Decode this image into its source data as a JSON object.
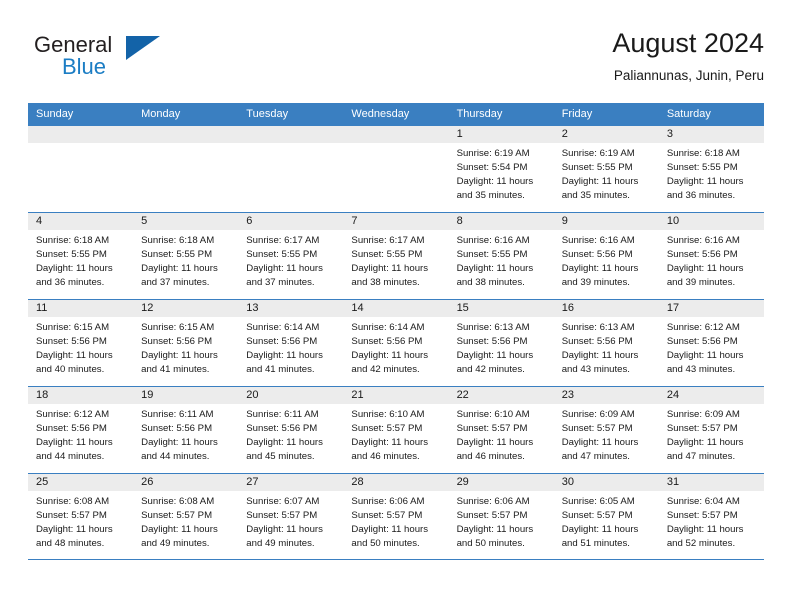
{
  "logo": {
    "word_top": "General",
    "word_bottom": "Blue",
    "triangle_color": "#1363a8",
    "blue_color": "#1b7dc4"
  },
  "header": {
    "title": "August 2024",
    "subtitle": "Paliannunas, Junin, Peru"
  },
  "theme": {
    "header_blue": "#3a7fc1",
    "day_band_gray": "#ececec"
  },
  "weekdays": [
    "Sunday",
    "Monday",
    "Tuesday",
    "Wednesday",
    "Thursday",
    "Friday",
    "Saturday"
  ],
  "weeks": [
    [
      {
        "day": "",
        "sunrise": "",
        "sunset": "",
        "daylight_line1": "",
        "daylight_line2": ""
      },
      {
        "day": "",
        "sunrise": "",
        "sunset": "",
        "daylight_line1": "",
        "daylight_line2": ""
      },
      {
        "day": "",
        "sunrise": "",
        "sunset": "",
        "daylight_line1": "",
        "daylight_line2": ""
      },
      {
        "day": "",
        "sunrise": "",
        "sunset": "",
        "daylight_line1": "",
        "daylight_line2": ""
      },
      {
        "day": "1",
        "sunrise": "Sunrise: 6:19 AM",
        "sunset": "Sunset: 5:54 PM",
        "daylight_line1": "Daylight: 11 hours",
        "daylight_line2": "and 35 minutes."
      },
      {
        "day": "2",
        "sunrise": "Sunrise: 6:19 AM",
        "sunset": "Sunset: 5:55 PM",
        "daylight_line1": "Daylight: 11 hours",
        "daylight_line2": "and 35 minutes."
      },
      {
        "day": "3",
        "sunrise": "Sunrise: 6:18 AM",
        "sunset": "Sunset: 5:55 PM",
        "daylight_line1": "Daylight: 11 hours",
        "daylight_line2": "and 36 minutes."
      }
    ],
    [
      {
        "day": "4",
        "sunrise": "Sunrise: 6:18 AM",
        "sunset": "Sunset: 5:55 PM",
        "daylight_line1": "Daylight: 11 hours",
        "daylight_line2": "and 36 minutes."
      },
      {
        "day": "5",
        "sunrise": "Sunrise: 6:18 AM",
        "sunset": "Sunset: 5:55 PM",
        "daylight_line1": "Daylight: 11 hours",
        "daylight_line2": "and 37 minutes."
      },
      {
        "day": "6",
        "sunrise": "Sunrise: 6:17 AM",
        "sunset": "Sunset: 5:55 PM",
        "daylight_line1": "Daylight: 11 hours",
        "daylight_line2": "and 37 minutes."
      },
      {
        "day": "7",
        "sunrise": "Sunrise: 6:17 AM",
        "sunset": "Sunset: 5:55 PM",
        "daylight_line1": "Daylight: 11 hours",
        "daylight_line2": "and 38 minutes."
      },
      {
        "day": "8",
        "sunrise": "Sunrise: 6:16 AM",
        "sunset": "Sunset: 5:55 PM",
        "daylight_line1": "Daylight: 11 hours",
        "daylight_line2": "and 38 minutes."
      },
      {
        "day": "9",
        "sunrise": "Sunrise: 6:16 AM",
        "sunset": "Sunset: 5:56 PM",
        "daylight_line1": "Daylight: 11 hours",
        "daylight_line2": "and 39 minutes."
      },
      {
        "day": "10",
        "sunrise": "Sunrise: 6:16 AM",
        "sunset": "Sunset: 5:56 PM",
        "daylight_line1": "Daylight: 11 hours",
        "daylight_line2": "and 39 minutes."
      }
    ],
    [
      {
        "day": "11",
        "sunrise": "Sunrise: 6:15 AM",
        "sunset": "Sunset: 5:56 PM",
        "daylight_line1": "Daylight: 11 hours",
        "daylight_line2": "and 40 minutes."
      },
      {
        "day": "12",
        "sunrise": "Sunrise: 6:15 AM",
        "sunset": "Sunset: 5:56 PM",
        "daylight_line1": "Daylight: 11 hours",
        "daylight_line2": "and 41 minutes."
      },
      {
        "day": "13",
        "sunrise": "Sunrise: 6:14 AM",
        "sunset": "Sunset: 5:56 PM",
        "daylight_line1": "Daylight: 11 hours",
        "daylight_line2": "and 41 minutes."
      },
      {
        "day": "14",
        "sunrise": "Sunrise: 6:14 AM",
        "sunset": "Sunset: 5:56 PM",
        "daylight_line1": "Daylight: 11 hours",
        "daylight_line2": "and 42 minutes."
      },
      {
        "day": "15",
        "sunrise": "Sunrise: 6:13 AM",
        "sunset": "Sunset: 5:56 PM",
        "daylight_line1": "Daylight: 11 hours",
        "daylight_line2": "and 42 minutes."
      },
      {
        "day": "16",
        "sunrise": "Sunrise: 6:13 AM",
        "sunset": "Sunset: 5:56 PM",
        "daylight_line1": "Daylight: 11 hours",
        "daylight_line2": "and 43 minutes."
      },
      {
        "day": "17",
        "sunrise": "Sunrise: 6:12 AM",
        "sunset": "Sunset: 5:56 PM",
        "daylight_line1": "Daylight: 11 hours",
        "daylight_line2": "and 43 minutes."
      }
    ],
    [
      {
        "day": "18",
        "sunrise": "Sunrise: 6:12 AM",
        "sunset": "Sunset: 5:56 PM",
        "daylight_line1": "Daylight: 11 hours",
        "daylight_line2": "and 44 minutes."
      },
      {
        "day": "19",
        "sunrise": "Sunrise: 6:11 AM",
        "sunset": "Sunset: 5:56 PM",
        "daylight_line1": "Daylight: 11 hours",
        "daylight_line2": "and 44 minutes."
      },
      {
        "day": "20",
        "sunrise": "Sunrise: 6:11 AM",
        "sunset": "Sunset: 5:56 PM",
        "daylight_line1": "Daylight: 11 hours",
        "daylight_line2": "and 45 minutes."
      },
      {
        "day": "21",
        "sunrise": "Sunrise: 6:10 AM",
        "sunset": "Sunset: 5:57 PM",
        "daylight_line1": "Daylight: 11 hours",
        "daylight_line2": "and 46 minutes."
      },
      {
        "day": "22",
        "sunrise": "Sunrise: 6:10 AM",
        "sunset": "Sunset: 5:57 PM",
        "daylight_line1": "Daylight: 11 hours",
        "daylight_line2": "and 46 minutes."
      },
      {
        "day": "23",
        "sunrise": "Sunrise: 6:09 AM",
        "sunset": "Sunset: 5:57 PM",
        "daylight_line1": "Daylight: 11 hours",
        "daylight_line2": "and 47 minutes."
      },
      {
        "day": "24",
        "sunrise": "Sunrise: 6:09 AM",
        "sunset": "Sunset: 5:57 PM",
        "daylight_line1": "Daylight: 11 hours",
        "daylight_line2": "and 47 minutes."
      }
    ],
    [
      {
        "day": "25",
        "sunrise": "Sunrise: 6:08 AM",
        "sunset": "Sunset: 5:57 PM",
        "daylight_line1": "Daylight: 11 hours",
        "daylight_line2": "and 48 minutes."
      },
      {
        "day": "26",
        "sunrise": "Sunrise: 6:08 AM",
        "sunset": "Sunset: 5:57 PM",
        "daylight_line1": "Daylight: 11 hours",
        "daylight_line2": "and 49 minutes."
      },
      {
        "day": "27",
        "sunrise": "Sunrise: 6:07 AM",
        "sunset": "Sunset: 5:57 PM",
        "daylight_line1": "Daylight: 11 hours",
        "daylight_line2": "and 49 minutes."
      },
      {
        "day": "28",
        "sunrise": "Sunrise: 6:06 AM",
        "sunset": "Sunset: 5:57 PM",
        "daylight_line1": "Daylight: 11 hours",
        "daylight_line2": "and 50 minutes."
      },
      {
        "day": "29",
        "sunrise": "Sunrise: 6:06 AM",
        "sunset": "Sunset: 5:57 PM",
        "daylight_line1": "Daylight: 11 hours",
        "daylight_line2": "and 50 minutes."
      },
      {
        "day": "30",
        "sunrise": "Sunrise: 6:05 AM",
        "sunset": "Sunset: 5:57 PM",
        "daylight_line1": "Daylight: 11 hours",
        "daylight_line2": "and 51 minutes."
      },
      {
        "day": "31",
        "sunrise": "Sunrise: 6:04 AM",
        "sunset": "Sunset: 5:57 PM",
        "daylight_line1": "Daylight: 11 hours",
        "daylight_line2": "and 52 minutes."
      }
    ]
  ]
}
